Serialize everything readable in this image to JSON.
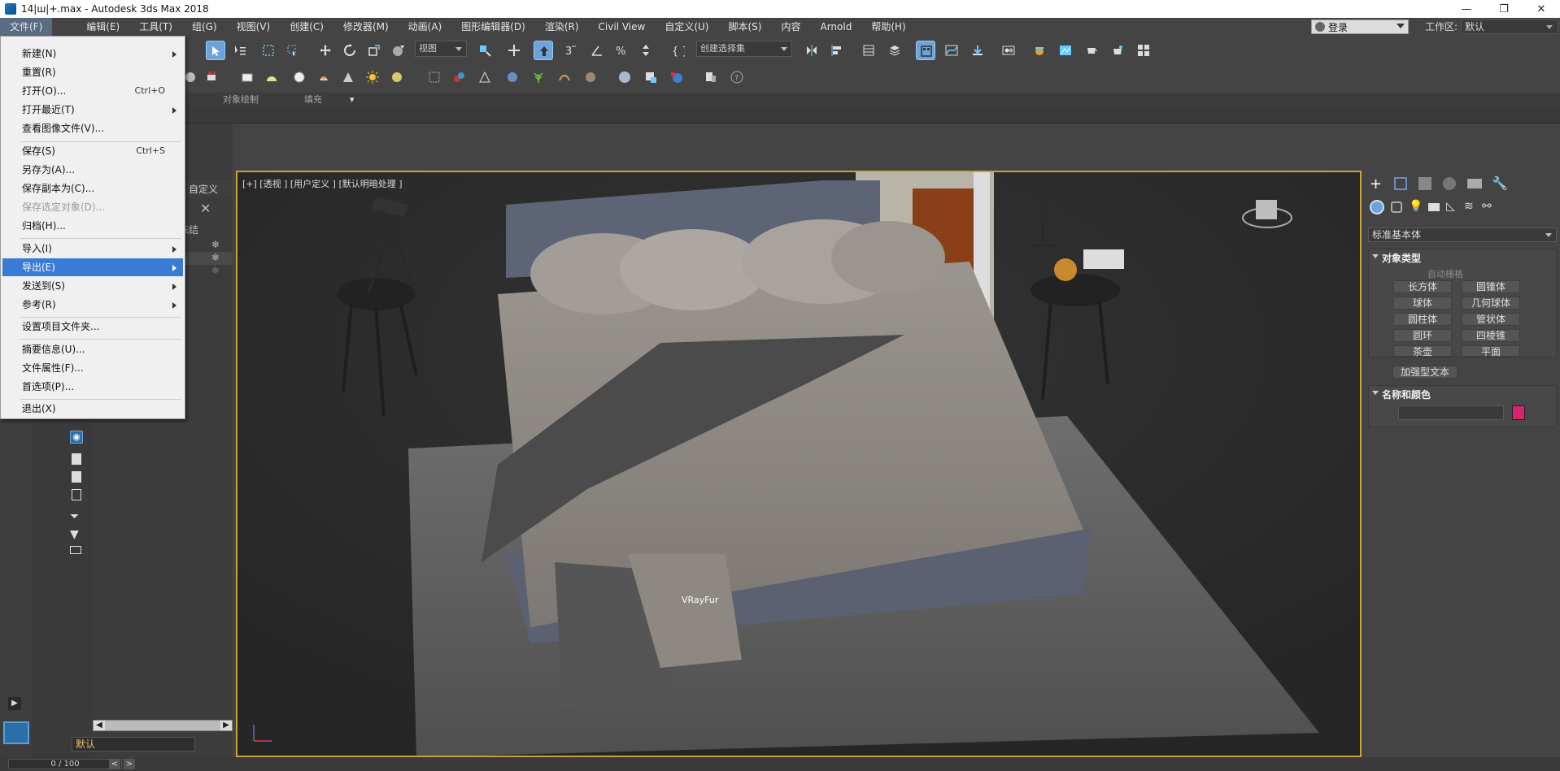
{
  "window": {
    "title": "14|ш|+.max - Autodesk 3ds Max 2018",
    "minimize": "—",
    "restore": "❐",
    "close": "✕"
  },
  "menubar": {
    "items": [
      "文件(F)",
      "编辑(E)",
      "工具(T)",
      "组(G)",
      "视图(V)",
      "创建(C)",
      "修改器(M)",
      "动画(A)",
      "图形编辑器(D)",
      "渲染(R)",
      "Civil View",
      "自定义(U)",
      "脚本(S)",
      "内容",
      "Arnold",
      "帮助(H)"
    ],
    "login_label": "登录",
    "workspace_label": "工作区:",
    "workspace_value": "默认"
  },
  "toolbar": {
    "view_combo": "视图",
    "selection_set_combo": "创建选择集"
  },
  "ribbon": {
    "tab_object_paint": "对象绘制",
    "tab_populate": "填充"
  },
  "file_menu": {
    "items": [
      {
        "label": "新建(N)",
        "submenu": true
      },
      {
        "label": "重置(R)"
      },
      {
        "label": "打开(O)...",
        "shortcut": "Ctrl+O"
      },
      {
        "label": "打开最近(T)",
        "submenu": true
      },
      {
        "label": "查看图像文件(V)..."
      },
      {
        "label": "保存(S)",
        "shortcut": "Ctrl+S"
      },
      {
        "label": "另存为(A)..."
      },
      {
        "label": "保存副本为(C)..."
      },
      {
        "label": "保存选定对象(D)...",
        "disabled": true
      },
      {
        "label": "归档(H)..."
      },
      {
        "label": "导入(I)",
        "submenu": true
      },
      {
        "label": "导出(E)",
        "submenu": true,
        "highlight": true
      },
      {
        "label": "发送到(S)",
        "submenu": true
      },
      {
        "label": "参考(R)",
        "submenu": true
      },
      {
        "label": "设置项目文件夹..."
      },
      {
        "label": "摘要信息(U)..."
      },
      {
        "label": "文件属性(F)..."
      },
      {
        "label": "首选项(P)..."
      },
      {
        "label": "退出(X)"
      }
    ]
  },
  "scene_explorer": {
    "customize_label": "自定义",
    "freeze_label": "冻结",
    "layer_value": "默认"
  },
  "viewport": {
    "label": "[+] [透视 ] [用户定义 ] [默认明暗处理 ]",
    "object_label": "VRayFur"
  },
  "command_panel": {
    "category_dropdown": "标准基本体",
    "object_type_title": "对象类型",
    "autogrid_label": "自动栅格",
    "object_buttons": [
      "长方体",
      "圆锥体",
      "球体",
      "几何球体",
      "圆柱体",
      "管状体",
      "圆环",
      "四棱锥",
      "茶壶",
      "平面",
      "加强型文本"
    ],
    "name_color_title": "名称和颜色",
    "object_color": "#d6246e"
  },
  "timeline": {
    "frame_display": "0 / 100"
  }
}
